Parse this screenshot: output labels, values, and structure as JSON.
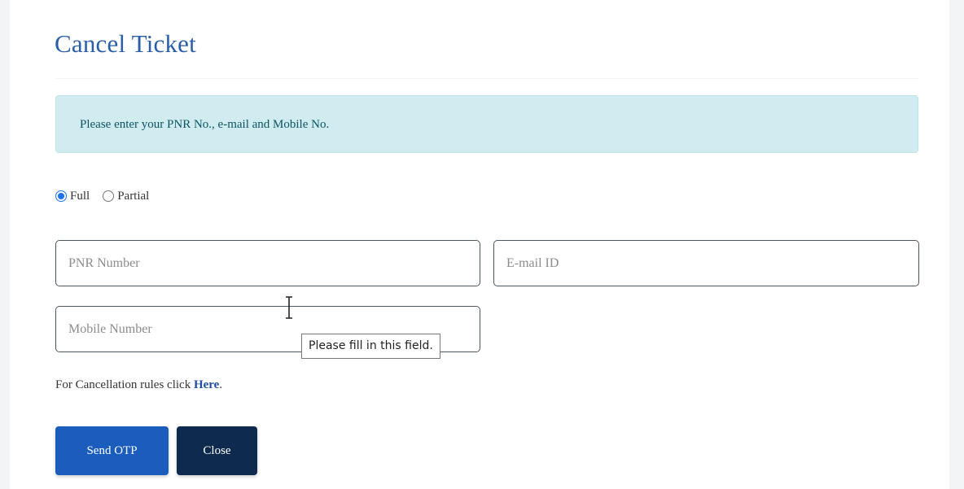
{
  "modal": {
    "title": "Cancel Ticket"
  },
  "alert": {
    "message": "Please enter your PNR No., e-mail and Mobile No."
  },
  "cancel_type": {
    "options": [
      {
        "label": "Full",
        "selected": true
      },
      {
        "label": "Partial",
        "selected": false
      }
    ]
  },
  "form": {
    "pnr": {
      "placeholder": "PNR Number",
      "value": ""
    },
    "email": {
      "placeholder": "E-mail ID",
      "value": ""
    },
    "mobile": {
      "placeholder": "Mobile Number",
      "value": ""
    },
    "validation_tooltip": "Please fill in this field."
  },
  "rules": {
    "prefix": "For Cancellation rules click ",
    "link_label": "Here",
    "suffix": "."
  },
  "buttons": {
    "send_otp": "Send OTP",
    "close": "Close"
  },
  "colors": {
    "title": "#2b5ea8",
    "alert_bg": "#d1ecf1",
    "primary_button": "#1a5dbd",
    "close_button": "#0e2b4f",
    "link": "#1d4f9e"
  }
}
